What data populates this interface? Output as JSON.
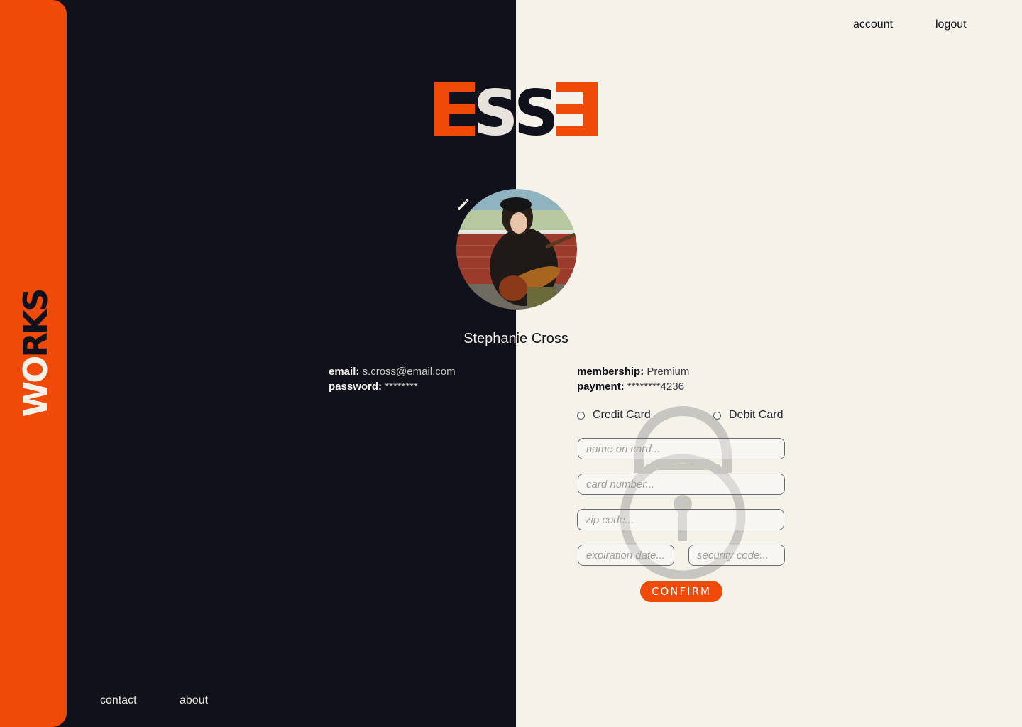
{
  "brand": {
    "logo_text": "ESSE",
    "side_word_first": "WO",
    "side_word_second": "RKS"
  },
  "top_nav": {
    "account": "account",
    "logout": "logout"
  },
  "bottom_nav": {
    "contact": "contact",
    "about": "about"
  },
  "profile": {
    "name": "Stephanie Cross",
    "email_label": "email:",
    "email": "s.cross@email.com",
    "password_label": "password:",
    "password": "********",
    "membership_label": "membership:",
    "membership": "Premium",
    "payment_label": "payment:",
    "payment": "********4236"
  },
  "payment_form": {
    "credit_label": "Credit Card",
    "debit_label": "Debit Card",
    "name_placeholder": "name on card...",
    "card_placeholder": "card number...",
    "zip_placeholder": "zip code...",
    "exp_placeholder": "expiration date...",
    "security_placeholder": "security code...",
    "confirm_label": "CONFIRM"
  },
  "colors": {
    "accent": "#ef4a07",
    "dark": "#11111b",
    "light": "#f5f2ea"
  },
  "icons": {
    "edit": "pencil-icon",
    "lock": "lock-icon"
  }
}
